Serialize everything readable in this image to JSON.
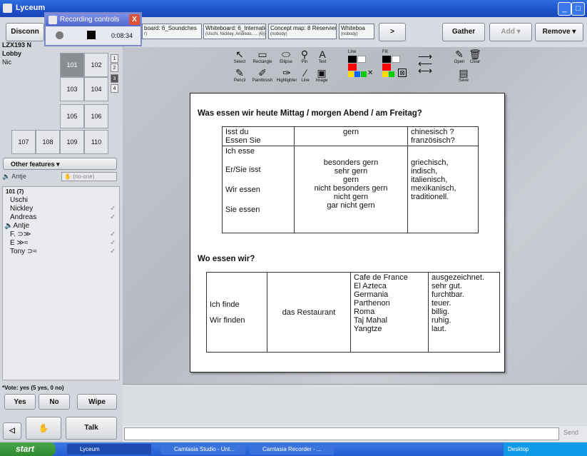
{
  "window": {
    "title": "Lyceum"
  },
  "recording": {
    "title": "Recording controls",
    "time": "0:08:34"
  },
  "tabs": {
    "disconnect": "Disconn",
    "whiteboard1": "board: 6_Soundches",
    "whiteboard1_sub": "r)",
    "whiteboard2": "Whiteboard: 6_Internationa",
    "whiteboard2_sub": "(Uschi, Nickley, Andreas, ... (6))",
    "concept": "Concept map: 8 Reservieru",
    "concept_sub": "(nobody)",
    "whiteboard3": "Whiteboa",
    "whiteboard3_sub": "(nobody)",
    "next": ">",
    "gather": "Gather",
    "add": "Add ▾",
    "remove": "Remove ▾"
  },
  "left": {
    "course": "LZX193 N",
    "lobby": "Lobby",
    "lobby_user": "Nic",
    "rooms": [
      "101",
      "102",
      "103",
      "104",
      "105",
      "106",
      "107",
      "108",
      "109",
      "110"
    ],
    "num_tags": [
      "1",
      "2",
      "3",
      "4"
    ],
    "other_features": "Other features ▾",
    "antje": "Antje",
    "no_one": "(no-one)",
    "room_header": "101 (7)",
    "users": [
      "Uschi",
      "Nickley",
      "Andreas",
      "Antje",
      "F.",
      "E",
      "Tony"
    ],
    "vote": "*Vote: yes (5 yes, 0 no)",
    "yes": "Yes",
    "no": "No",
    "wipe": "Wipe",
    "talk": "Talk"
  },
  "toolbar": {
    "tools_row1": [
      "Select",
      "Rectangle",
      "Ellipse",
      "Pin",
      "Text"
    ],
    "tools_row2": [
      "Pencil",
      "Paintbrush",
      "Highlighter",
      "Line",
      "Image"
    ],
    "line": "Line",
    "fill": "Fill",
    "open": "Open",
    "clear": "Clear",
    "save": "Save",
    "colors": [
      "#000000",
      "#ffffff",
      "#ff0000",
      "#00aa00",
      "#ffff00",
      "#0000ff"
    ]
  },
  "doc": {
    "q1": "Was essen wir heute Mittag / morgen Abend / am Freitag?",
    "t1": {
      "h1": "Isst du\nEssen Sie",
      "h2": "gern",
      "h3": "chinesisch ?\nfranzösisch?",
      "c1": [
        "Ich esse",
        "Er/Sie isst",
        "Wir essen",
        "Sie essen"
      ],
      "c2": [
        "besonders gern",
        "sehr gern",
        "gern",
        "nicht besonders gern",
        "nicht gern",
        "gar nicht gern"
      ],
      "c3": [
        "griechisch,",
        "indisch,",
        "italienisch,",
        "mexikanisch,",
        "traditionell."
      ]
    },
    "q2": "Wo essen wir?",
    "t2": {
      "c1": [
        "Ich finde",
        "Wir finden"
      ],
      "c2": "das Restaurant",
      "c3": [
        "Cafe de France",
        "El Azteca",
        "Germania",
        "Parthenon",
        "Roma",
        "Taj Mahal",
        "Yangtze"
      ],
      "c4": [
        "ausgezeichnet.",
        "sehr gut.",
        "furchtbar.",
        "teuer.",
        "billig.",
        "ruhig.",
        "laut."
      ]
    }
  },
  "bottom": {
    "send": "Send"
  },
  "taskbar": {
    "start": "start",
    "items": [
      "Lyceum",
      "Camtasia Studio - Unt...",
      "Camtasia Recorder - ..."
    ],
    "tray": "Desktop"
  }
}
